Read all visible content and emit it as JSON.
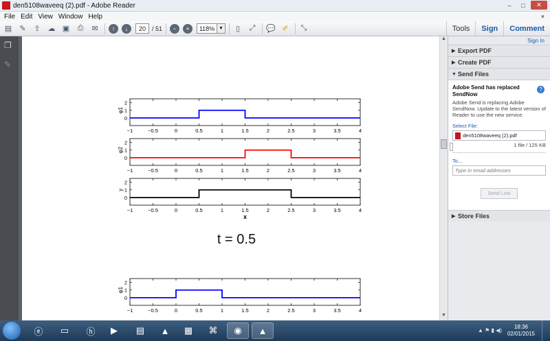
{
  "window": {
    "title": "den5108waveeq (2).pdf - Adobe Reader",
    "controls": {
      "minimize": "–",
      "maximize": "□",
      "close": "✕"
    }
  },
  "menu": [
    "File",
    "Edit",
    "View",
    "Window",
    "Help"
  ],
  "menu_close": "×",
  "toolbar": {
    "page_current": "20",
    "page_total": "/ 51",
    "zoom": "118%",
    "tools_label": "Tools",
    "sign_label": "Sign",
    "comment_label": "Comment"
  },
  "right_panel": {
    "sign_in": "Sign In",
    "export_pdf": "Export PDF",
    "create_pdf": "Create PDF",
    "send_files": "Send Files",
    "card_title": "Adobe Send has replaced SendNow",
    "card_text": "Adobe Send is replacing Adobe SendNow. Update to the latest version of Reader to use the new service.",
    "select_file_label": "Select File:",
    "file_name": "den5108waveeq (2).pdf",
    "file_size": "1 file / 125 KB",
    "to_label": "To...",
    "email_placeholder": "Type in email addresses",
    "send_link": "Send Link",
    "store_files": "Store Files"
  },
  "document": {
    "caption": "t = 0.5",
    "x_label": "x"
  },
  "chart_data": [
    {
      "type": "line",
      "ylabel": "φ1",
      "xlim": [
        -1,
        4
      ],
      "ylim": [
        -1,
        2.5
      ],
      "x_ticks": [
        "−1",
        "−0.5",
        "0",
        "0.5",
        "1",
        "1.5",
        "2",
        "2.5",
        "3",
        "3.5",
        "4"
      ],
      "y_ticks": [
        "0",
        "1",
        "2"
      ],
      "color": "#0000ff",
      "x": [
        -1,
        0.5,
        0.5,
        1.5,
        1.5,
        4
      ],
      "y": [
        0,
        0,
        1,
        1,
        0,
        0
      ]
    },
    {
      "type": "line",
      "ylabel": "φ2",
      "xlim": [
        -1,
        4
      ],
      "ylim": [
        -1,
        2.5
      ],
      "x_ticks": [
        "−1",
        "−0.5",
        "0",
        "0.5",
        "1",
        "1.5",
        "2",
        "2.5",
        "3",
        "3.5",
        "4"
      ],
      "y_ticks": [
        "0",
        "1",
        "2"
      ],
      "color": "#ff0000",
      "x": [
        -1,
        1.5,
        1.5,
        2.5,
        2.5,
        4
      ],
      "y": [
        0,
        0,
        1,
        1,
        0,
        0
      ]
    },
    {
      "type": "line",
      "ylabel": "y",
      "xlim": [
        -1,
        4
      ],
      "ylim": [
        -1,
        2.5
      ],
      "x_ticks": [
        "−1",
        "−0.5",
        "0",
        "0.5",
        "1",
        "1.5",
        "2",
        "2.5",
        "3",
        "3.5",
        "4"
      ],
      "y_ticks": [
        "0",
        "1",
        "2"
      ],
      "color": "#000000",
      "x": [
        -1,
        0.5,
        0.5,
        2.5,
        2.5,
        4
      ],
      "y": [
        0,
        0,
        1,
        1,
        0,
        0
      ]
    },
    {
      "type": "line",
      "ylabel": "φ1",
      "xlim": [
        -1,
        4
      ],
      "ylim": [
        -1,
        2.5
      ],
      "x_ticks": [
        "−1",
        "−0.5",
        "0",
        "0.5",
        "1",
        "1.5",
        "2",
        "2.5",
        "3",
        "3.5",
        "4"
      ],
      "y_ticks": [
        "0",
        "1",
        "2"
      ],
      "color": "#0000ff",
      "x": [
        -1,
        0,
        0,
        1,
        1,
        4
      ],
      "y": [
        0,
        0,
        1,
        1,
        0,
        0
      ]
    }
  ],
  "taskbar": {
    "time": "18:36",
    "date": "02/01/2015"
  }
}
